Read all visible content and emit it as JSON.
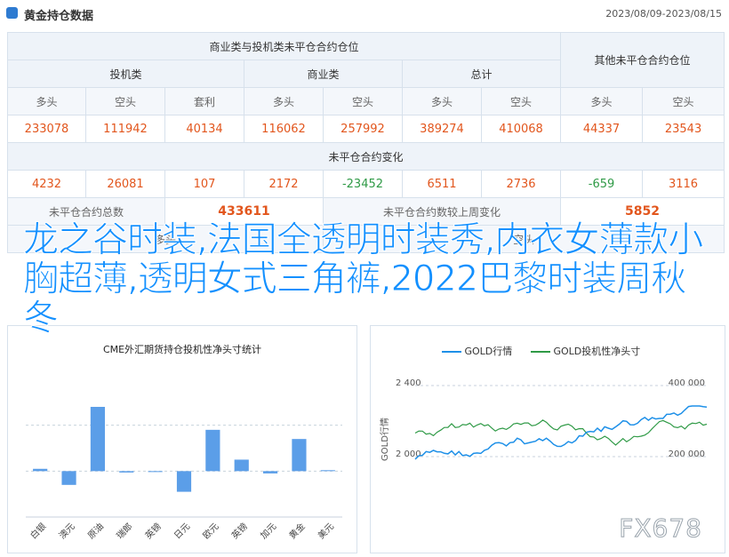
{
  "header": {
    "title": "黄金持仓数据",
    "date_range": "2023/08/09-2023/08/15"
  },
  "table": {
    "group_commercial": "商业类与投机类未平仓合约仓位",
    "group_other": "其他未平仓合约仓位",
    "sub_speculative": "投机类",
    "sub_commercial": "商业类",
    "sub_total": "总计",
    "col_long": "多头",
    "col_short": "空头",
    "col_hedge": "套利",
    "positions": [
      "233078",
      "111942",
      "40134",
      "116062",
      "257992",
      "389274",
      "410068",
      "44337",
      "23543"
    ],
    "change_title": "未平仓合约变化",
    "changes": [
      "4232",
      "26081",
      "107",
      "2172",
      "-23452",
      "6511",
      "2736",
      "-659",
      "3116"
    ],
    "oi_total_label": "未平仓合约总数",
    "oi_total_value": "433611",
    "oi_change_label": "未平仓合约数较上周变化",
    "oi_change_value": "5852",
    "row4_left_hidden": "多头",
    "row4_right_hidden": "空头"
  },
  "left_chart": {
    "chart_data": {
      "type": "bar",
      "title": "CME外汇期货持仓投机性净头寸统计",
      "categories": [
        "白银",
        "澳元",
        "原油",
        "瑞郎",
        "英镑",
        "日元",
        "欧元",
        "英镑",
        "加元",
        "黄金",
        "美元"
      ],
      "values": [
        0.5,
        -3,
        14,
        -0.3,
        -0.2,
        -4.5,
        9,
        2.5,
        -0.5,
        7,
        0.2
      ],
      "ylim": [
        -10,
        20
      ],
      "grid": true
    }
  },
  "right_chart": {
    "chart_data": {
      "type": "line",
      "series": [
        {
          "name": "GOLD行情",
          "color": "#1e90e8"
        },
        {
          "name": "GOLD投机性净头寸",
          "color": "#2f9a46"
        }
      ],
      "left_ticks": [
        "2 400",
        "2 000"
      ],
      "right_ticks": [
        "400 000",
        "200 000"
      ],
      "ylabel": "GOLD行情"
    }
  },
  "overlay_text": "龙之谷时装,法国全透明时装秀,内衣女薄款小胸超薄,透明女式三角裤,2022巴黎时装周秋冬",
  "watermark": "FX678",
  "colors": {
    "accent": "#2e7bd1",
    "positive": "#e2561d",
    "negative": "#2f9a46"
  }
}
